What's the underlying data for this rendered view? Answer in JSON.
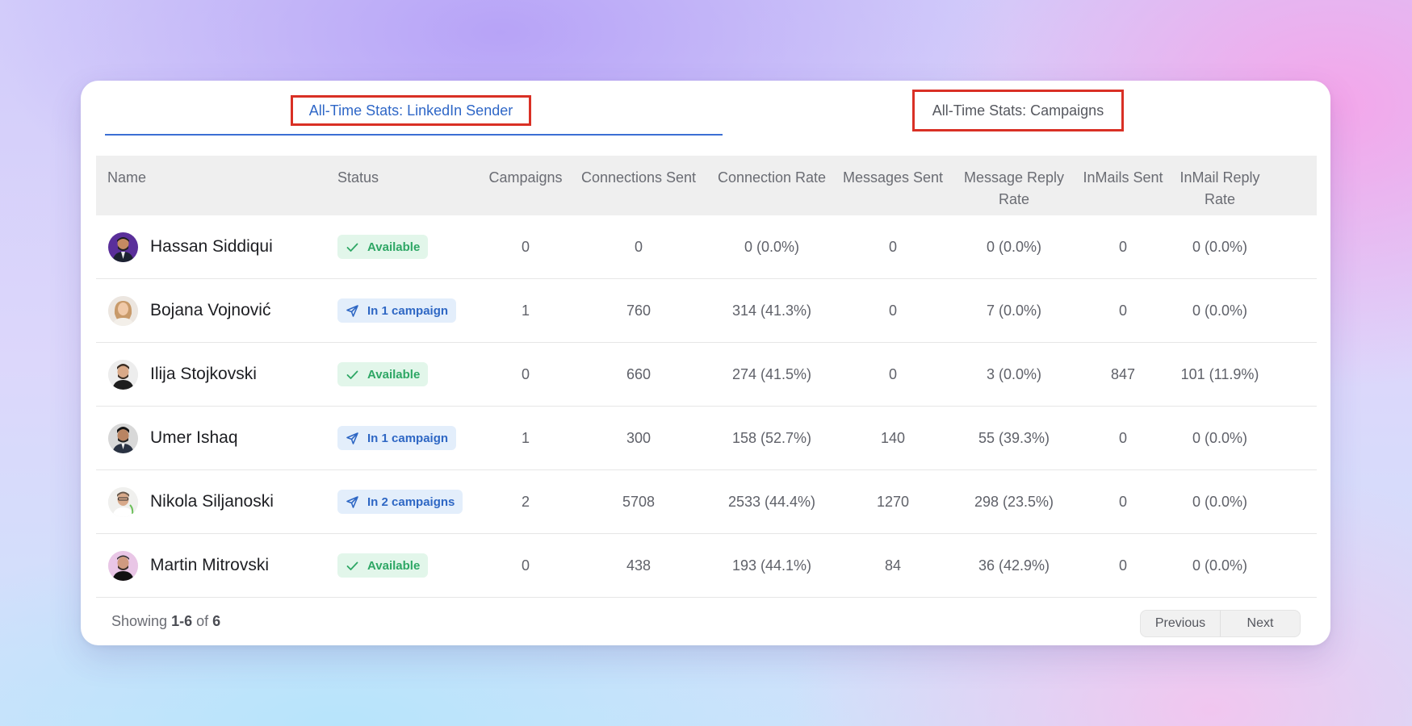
{
  "tabs": {
    "sender": "All-Time Stats: LinkedIn Sender",
    "campaigns": "All-Time Stats: Campaigns"
  },
  "table": {
    "headers": {
      "name": "Name",
      "status": "Status",
      "campaigns": "Campaigns",
      "connections_sent": "Connections Sent",
      "connection_rate": "Connection Rate",
      "messages_sent": "Messages Sent",
      "message_reply_rate_1": "Message Reply",
      "message_reply_rate_2": "Rate",
      "inmails_sent": "InMails Sent",
      "inmail_reply_rate_1": "InMail Reply",
      "inmail_reply_rate_2": "Rate"
    },
    "rows": [
      {
        "name": "Hassan Siddiqui",
        "status": "Available",
        "status_type": "available",
        "campaigns": "0",
        "connections_sent": "0",
        "connection_rate": "0 (0.0%)",
        "messages_sent": "0",
        "message_reply_rate": "0 (0.0%)",
        "inmails_sent": "0",
        "inmail_reply_rate": "0 (0.0%)"
      },
      {
        "name": "Bojana Vojnović",
        "status": "In 1 campaign",
        "status_type": "campaign",
        "campaigns": "1",
        "connections_sent": "760",
        "connection_rate": "314 (41.3%)",
        "messages_sent": "0",
        "message_reply_rate": "7 (0.0%)",
        "inmails_sent": "0",
        "inmail_reply_rate": "0 (0.0%)"
      },
      {
        "name": "Ilija Stojkovski",
        "status": "Available",
        "status_type": "available",
        "campaigns": "0",
        "connections_sent": "660",
        "connection_rate": "274 (41.5%)",
        "messages_sent": "0",
        "message_reply_rate": "3 (0.0%)",
        "inmails_sent": "847",
        "inmail_reply_rate": "101 (11.9%)"
      },
      {
        "name": "Umer Ishaq",
        "status": "In 1 campaign",
        "status_type": "campaign",
        "campaigns": "1",
        "connections_sent": "300",
        "connection_rate": "158 (52.7%)",
        "messages_sent": "140",
        "message_reply_rate": "55 (39.3%)",
        "inmails_sent": "0",
        "inmail_reply_rate": "0 (0.0%)"
      },
      {
        "name": "Nikola Siljanoski",
        "status": "In 2 campaigns",
        "status_type": "campaign",
        "campaigns": "2",
        "connections_sent": "5708",
        "connection_rate": "2533 (44.4%)",
        "messages_sent": "1270",
        "message_reply_rate": "298 (23.5%)",
        "inmails_sent": "0",
        "inmail_reply_rate": "0 (0.0%)"
      },
      {
        "name": "Martin Mitrovski",
        "status": "Available",
        "status_type": "available",
        "campaigns": "0",
        "connections_sent": "438",
        "connection_rate": "193 (44.1%)",
        "messages_sent": "84",
        "message_reply_rate": "36 (42.9%)",
        "inmails_sent": "0",
        "inmail_reply_rate": "0 (0.0%)"
      }
    ]
  },
  "footer": {
    "showing_prefix": "Showing",
    "showing_range": "1-6",
    "showing_of": "of",
    "showing_total": "6",
    "previous": "Previous",
    "next": "Next"
  },
  "icons": {
    "available": "check-icon",
    "campaign": "paper-plane-icon"
  },
  "colors": {
    "tab_active": "#2f67c7",
    "highlight_box": "#d93025",
    "available_bg": "#e2f6ea",
    "available_text": "#2ea765",
    "campaign_bg": "#e3eefb",
    "campaign_text": "#2e67c4"
  }
}
